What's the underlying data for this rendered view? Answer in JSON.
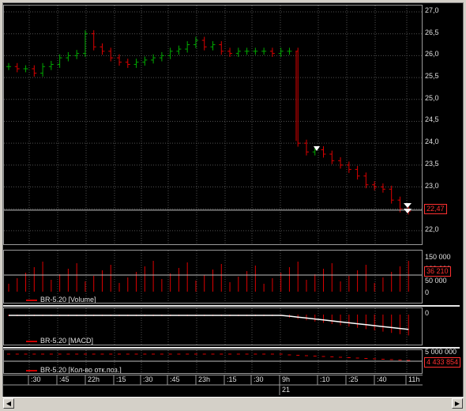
{
  "symbol": "BR-5.20",
  "price_axis": {
    "ticks": [
      "27,0",
      "26,5",
      "26,0",
      "25,5",
      "25,0",
      "24,5",
      "24,0",
      "23,5",
      "23,0",
      "22,5",
      "22,0"
    ],
    "current": "22,47"
  },
  "volume_panel": {
    "legend": "BR-5.20 [Volume]",
    "ticks": [
      "150 000",
      "100 000",
      "50 000",
      "0"
    ],
    "current": "36 210"
  },
  "macd_panel": {
    "legend": "BR-5.20 [MACD]",
    "ticks": [
      "0"
    ]
  },
  "oi_panel": {
    "legend": "BR-5.20 [Кол-во отк.поз.]",
    "ticks": [
      "5 000 000"
    ],
    "current": "4 433 854"
  },
  "time_axis": {
    "labels": [
      ":30",
      ":45",
      "22h",
      ":15",
      ":30",
      ":45",
      "23h",
      ":15",
      ":30",
      "9h",
      ":10",
      ":25",
      ":40",
      "11h"
    ],
    "date": "21"
  },
  "colors": {
    "up": "#00aa00",
    "down": "#dd0000",
    "grid": "#505050",
    "macd_line": "#ffffff",
    "current_box": "#ff3030"
  },
  "chart_data": {
    "type": "bar",
    "title": "",
    "series": [
      {
        "name": "BR-5.20",
        "values": [
          25.75,
          25.7,
          25.7,
          25.6,
          25.75,
          25.8,
          25.95,
          26.0,
          26.05,
          26.5,
          26.2,
          26.1,
          25.95,
          25.85,
          25.8,
          25.85,
          25.9,
          25.95,
          26.0,
          26.1,
          26.15,
          26.25,
          26.35,
          26.2,
          26.25,
          26.1,
          26.05,
          26.1,
          26.1,
          26.1,
          26.1,
          26.05,
          26.1,
          26.1,
          24.0,
          23.8,
          23.85,
          23.75,
          23.6,
          23.5,
          23.4,
          23.25,
          23.05,
          23.0,
          22.95,
          22.7,
          22.5,
          22.45
        ]
      }
    ],
    "ylim": [
      21.8,
      27.0
    ]
  }
}
